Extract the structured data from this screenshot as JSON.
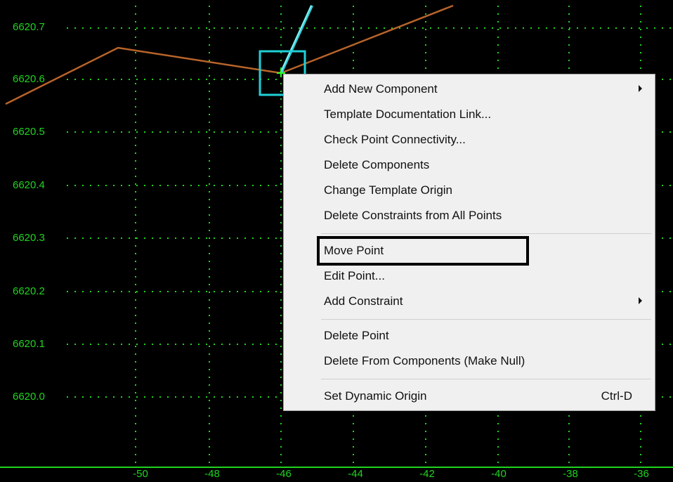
{
  "y_axis_labels": [
    "6620.7",
    "6620.6",
    "6620.5",
    "6620.4",
    "6620.3",
    "6620.2",
    "6620.1",
    "6620.0"
  ],
  "x_axis_labels": [
    "-50",
    "-48",
    "-46",
    "-44",
    "-42",
    "-40",
    "-38",
    "-36"
  ],
  "colors": {
    "background": "#000000",
    "grid": "#1fd41f",
    "template_line": "#b8642a",
    "selection_box": "#1fd0d8",
    "menu_bg": "#f0f0f0"
  },
  "context_menu": {
    "items": [
      {
        "label": "Add New Component",
        "submenu": true
      },
      {
        "label": "Template Documentation Link..."
      },
      {
        "label": "Check Point Connectivity..."
      },
      {
        "label": "Delete Components"
      },
      {
        "label": "Change Template Origin"
      },
      {
        "label": "Delete Constraints from All Points"
      },
      {
        "label": "Move Point",
        "highlighted": true
      },
      {
        "label": "Edit Point..."
      },
      {
        "label": "Add Constraint",
        "submenu": true
      },
      {
        "label": "Delete Point"
      },
      {
        "label": "Delete From Components (Make Null)"
      },
      {
        "label": "Set Dynamic Origin",
        "shortcut": "Ctrl-D"
      }
    ]
  }
}
